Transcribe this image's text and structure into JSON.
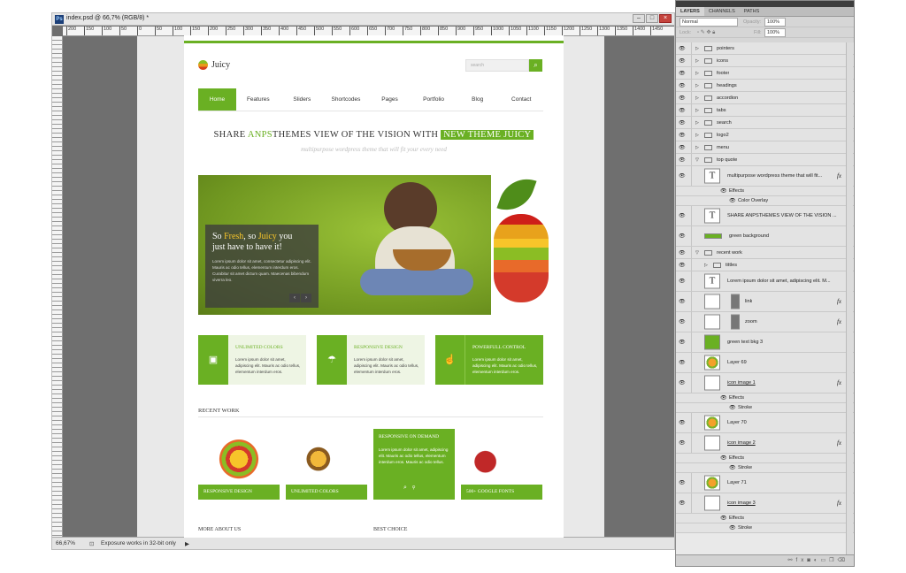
{
  "window": {
    "title": "index.psd @ 66,7% (RGB/8) *"
  },
  "ruler_marks": [
    "200",
    "150",
    "100",
    "50",
    "0",
    "50",
    "100",
    "150",
    "200",
    "250",
    "300",
    "350",
    "400",
    "450",
    "500",
    "550",
    "600",
    "650",
    "700",
    "750",
    "800",
    "850",
    "900",
    "950",
    "1000",
    "1050",
    "1100",
    "1150",
    "1200",
    "1250",
    "1300",
    "1350",
    "1400",
    "1450"
  ],
  "site": {
    "logo": "Juicy",
    "search_placeholder": "search",
    "nav": [
      "Home",
      "Features",
      "Sliders",
      "Shortcodes",
      "Pages",
      "Portfolio",
      "Blog",
      "Contact"
    ],
    "headline": {
      "part1": "SHARE",
      "part2": "ANPS",
      "part3": "THEMES VIEW OF THE VISION WITH",
      "highlight": "NEW THEME JUICY"
    },
    "subhead": "multipurpose wordpress theme that will fit your every need",
    "slider": {
      "line1_pre": "So ",
      "line1_fresh": "Fresh",
      "line1_mid": ", so ",
      "line1_juicy": "Juicy",
      "line1_post": " you",
      "line2": "just have to have it!",
      "text": "Lorem ipsum dolor sit amet, consectetur adipiscing elit. Mauris ac odio tellus, elementum interdum eros. Curabitur sit amet dictum quam. Maecenas bibendum viverra leo."
    },
    "features": [
      {
        "title": "UNLIMITED COLORS",
        "text": "Lorem ipsum dolor sit amet, adipiscing elit. Mauris ac odio tellus, elementum interdum eros.",
        "icon": "briefcase-icon"
      },
      {
        "title": "RESPONSIVE DESIGN",
        "text": "Lorem ipsum dolor sit amet, adipiscing elit. Mauris ac odio tellus, elementum interdum eros.",
        "icon": "umbrella-icon"
      },
      {
        "title": "POWERFULL CONTROL",
        "text": "Lorem ipsum dolor sit amet, adipiscing elit. Mauris ac odio tellus, elementum interdum eros.",
        "icon": "hand-icon"
      }
    ],
    "recent_work_title": "RECENT WORK",
    "works": [
      {
        "label": "RESPONSIVE DESIGN"
      },
      {
        "label": "UNLIMITED COLORS"
      },
      {
        "label": "RESPONSIVE ON DEMAND",
        "text": "Lorem ipsum dolor sit amet, adipiscing elit. Mauris ac odio tellus, elementum interdum eros. Mauris ac odio tellus."
      },
      {
        "label": "500+ GOOGLE FONTS"
      }
    ],
    "more_about": "MORE ABOUT US",
    "best_choice": "BEST CHOICE"
  },
  "status": {
    "zoom": "66,67%",
    "info": "Exposure works in 32-bit only"
  },
  "panel": {
    "tabs": [
      "LAYERS",
      "CHANNELS",
      "PATHS"
    ],
    "blend": "Normal",
    "opacity_label": "Opacity:",
    "opacity": "100%",
    "lock_label": "Lock:",
    "fill_label": "Fill:",
    "fill": "100%",
    "layers": [
      {
        "name": "pointers",
        "kind": "group",
        "indent": 0
      },
      {
        "name": "icons",
        "kind": "group",
        "indent": 0
      },
      {
        "name": "footer",
        "kind": "group",
        "indent": 0
      },
      {
        "name": "headings",
        "kind": "group",
        "indent": 0
      },
      {
        "name": "accordion",
        "kind": "group",
        "indent": 0
      },
      {
        "name": "tabs",
        "kind": "group",
        "indent": 0
      },
      {
        "name": "search",
        "kind": "group",
        "indent": 0
      },
      {
        "name": "logo2",
        "kind": "group",
        "indent": 0
      },
      {
        "name": "menu",
        "kind": "group",
        "indent": 0
      },
      {
        "name": "top quote",
        "kind": "group-open",
        "indent": 0
      },
      {
        "name": "multipurpose wordpress theme that will fit...",
        "kind": "text",
        "indent": 1,
        "fx": true
      },
      {
        "name": "Effects",
        "kind": "effects",
        "indent": 2
      },
      {
        "name": "Color Overlay",
        "kind": "effect",
        "indent": 3
      },
      {
        "name": "SHARE ANPSTHEMES VIEW OF THE VISION ...",
        "kind": "text",
        "indent": 1
      },
      {
        "name": "green background",
        "kind": "swatch",
        "indent": 1
      },
      {
        "name": "recent work",
        "kind": "group-open",
        "indent": 0
      },
      {
        "name": "tittles",
        "kind": "group",
        "indent": 1
      },
      {
        "name": "Lorem ipsum dolor sit amet,  adipiscing elit. M...",
        "kind": "text",
        "indent": 1
      },
      {
        "name": "link",
        "kind": "masked",
        "indent": 1,
        "fx": true
      },
      {
        "name": "zoom",
        "kind": "masked",
        "indent": 1,
        "fx": true
      },
      {
        "name": "green text bkg 3",
        "kind": "green",
        "indent": 1
      },
      {
        "name": "Layer 69",
        "kind": "image",
        "indent": 1
      },
      {
        "name": "icon image 1",
        "kind": "plain",
        "indent": 1,
        "fx": true
      },
      {
        "name": "Effects",
        "kind": "effects",
        "indent": 2
      },
      {
        "name": "Stroke",
        "kind": "effect",
        "indent": 3
      },
      {
        "name": "Layer 70",
        "kind": "image",
        "indent": 1
      },
      {
        "name": "icon image 2",
        "kind": "plain",
        "indent": 1,
        "fx": true
      },
      {
        "name": "Effects",
        "kind": "effects",
        "indent": 2
      },
      {
        "name": "Stroke",
        "kind": "effect",
        "indent": 3
      },
      {
        "name": "Layer 71",
        "kind": "image",
        "indent": 1
      },
      {
        "name": "icon image 3",
        "kind": "plain",
        "indent": 1,
        "fx": true
      },
      {
        "name": "Effects",
        "kind": "effects",
        "indent": 2
      },
      {
        "name": "Stroke",
        "kind": "effect",
        "indent": 3
      }
    ]
  }
}
